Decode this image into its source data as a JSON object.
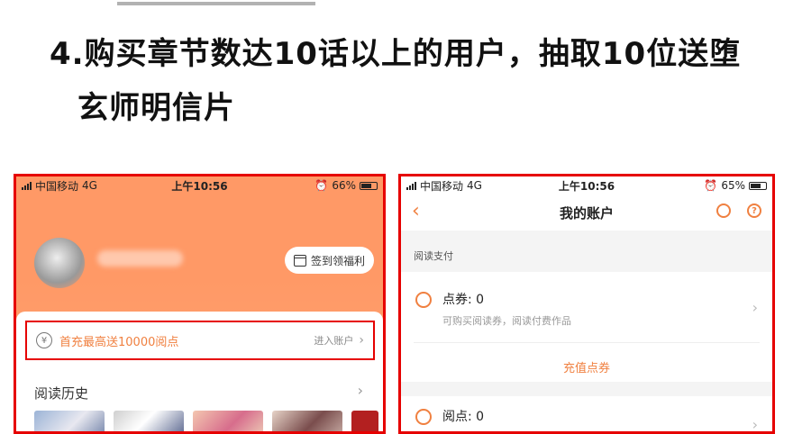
{
  "headline": {
    "line1": "4.购买章节数达10话以上的用户，抽取10位送堕",
    "line2": "玄师明信片"
  },
  "left_phone": {
    "status": {
      "carrier": "中国移动",
      "network": "4G",
      "time": "上午10:56",
      "battery": "66%"
    },
    "checkin_label": "签到领福利",
    "promo": {
      "text": "首充最高送10000阅点",
      "link": "进入账户"
    },
    "section_title": "阅读历史",
    "icons": {
      "checkin": "calendar-icon",
      "promo": "yen-icon"
    }
  },
  "right_phone": {
    "status": {
      "carrier": "中国移动",
      "network": "4G",
      "time": "上午10:56",
      "battery": "65%"
    },
    "title": "我的账户",
    "section_label": "阅读支付",
    "coupons": {
      "label": "点券: 0",
      "desc": "可购买阅读券，阅读付费作品",
      "action": "充值点券"
    },
    "points": {
      "label": "阅点: 0"
    },
    "icons": {
      "back": "back-arrow-icon",
      "first": "coin-icon",
      "help": "help-icon"
    }
  },
  "colors": {
    "accent": "#ff9966",
    "highlight_border": "#e60000",
    "text_orange": "#f08040"
  }
}
